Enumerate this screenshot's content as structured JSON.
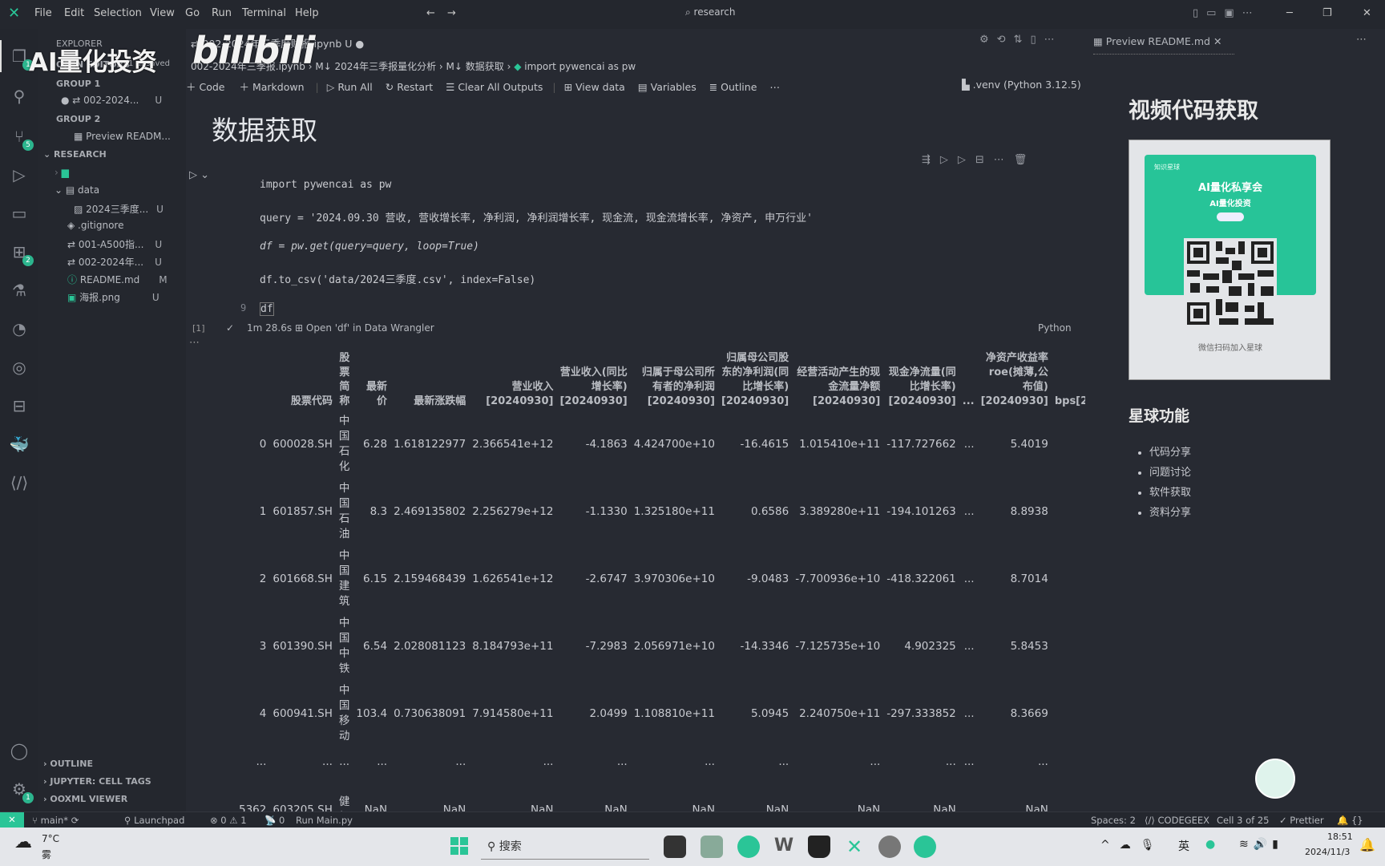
{
  "menu": [
    "File",
    "Edit",
    "Selection",
    "View",
    "Go",
    "Run",
    "Terminal",
    "Help"
  ],
  "search": "research",
  "watermark": {
    "channel": "AI量化投资",
    "logo": "bilibili"
  },
  "sidebar": {
    "title": "EXPLORER",
    "open_editors": "OPEN EDITORS",
    "open_editors_count": "1 unsaved",
    "group1": "GROUP 1",
    "group1_item": "002-2024...",
    "group1_status": "U",
    "group2": "GROUP 2",
    "group2_item": "Preview READM...",
    "research": "RESEARCH",
    "tree": [
      {
        "label": "data",
        "status": ""
      },
      {
        "label": "2024三季度...",
        "status": "U"
      },
      {
        "label": ".gitignore",
        "status": ""
      },
      {
        "label": "001-A500指...",
        "status": "U"
      },
      {
        "label": "002-2024年...",
        "status": "U"
      },
      {
        "label": "README.md",
        "status": "M"
      },
      {
        "label": "海报.png",
        "status": "U"
      }
    ],
    "outline": "OUTLINE",
    "cell_tags": "JUPYTER: CELL TAGS",
    "ooxml": "OOXML VIEWER"
  },
  "editor": {
    "tab": "002-2024年三季度财报.ipynb",
    "tab_status": "U",
    "breadcrumb": [
      "002-2024年三季报.ipynb",
      "M↓ 2024年三季报量化分析",
      "M↓ 数据获取",
      "import pywencai as pw"
    ],
    "toolbar": [
      "Code",
      "Markdown",
      "Run All",
      "Restart",
      "Clear All Outputs",
      "View data",
      "Variables",
      "Outline"
    ],
    "kernel": ".venv (Python 3.12.5)",
    "heading": "数据获取",
    "code": [
      "import pywencai as pw",
      "query = '2024.09.30 营收, 营收增长率, 净利润, 净利润增长率, 现金流, 现金流增长率, 净资产, 申万行业'",
      "df = pw.get(query=query, loop=True)",
      "df.to_csv('data/2024三季度.csv', index=False)",
      "df"
    ],
    "last_line_number": "9",
    "exec_count": "[1]",
    "exec_time": "1m 28.6s",
    "data_wrangler": "Open 'df' in Data Wrangler",
    "language": "Python"
  },
  "table": {
    "headers": [
      "",
      "股票代码",
      "股票简称",
      "最新价",
      "最新涨跌幅",
      "营业收入[20240930]",
      "营业收入(同比增长率)[20240930]",
      "归属于母公司所有者的净利润[20240930]",
      "归属母公司股东的净利润(同比增长率)[20240930]",
      "经营活动产生的现金流量净额[20240930]",
      "现金净流量(同比增长率)[20240930]",
      "...",
      "净资产收益率roe(摊薄,公布值)[20240930]",
      "bps[2"
    ],
    "rows": [
      [
        "0",
        "600028.SH",
        "中国石化",
        "6.28",
        "1.618122977",
        "2.366541e+12",
        "-4.1863",
        "4.424700e+10",
        "-16.4615",
        "1.015410e+11",
        "-117.727662",
        "...",
        "5.4019",
        ""
      ],
      [
        "1",
        "601857.SH",
        "中国石油",
        "8.3",
        "2.469135802",
        "2.256279e+12",
        "-1.1330",
        "1.325180e+11",
        "0.6586",
        "3.389280e+11",
        "-194.101263",
        "...",
        "8.8938",
        ""
      ],
      [
        "2",
        "601668.SH",
        "中国建筑",
        "6.15",
        "2.159468439",
        "1.626541e+12",
        "-2.6747",
        "3.970306e+10",
        "-9.0483",
        "-7.700936e+10",
        "-418.322061",
        "...",
        "8.7014",
        ""
      ],
      [
        "3",
        "601390.SH",
        "中国中铁",
        "6.54",
        "2.028081123",
        "8.184793e+11",
        "-7.2983",
        "2.056971e+10",
        "-14.3346",
        "-7.125735e+10",
        "4.902325",
        "...",
        "5.8453",
        ""
      ],
      [
        "4",
        "600941.SH",
        "中国移动",
        "103.4",
        "0.730638091",
        "7.914580e+11",
        "2.0499",
        "1.108810e+11",
        "5.0945",
        "2.240750e+11",
        "-297.333852",
        "...",
        "8.3669",
        ""
      ],
      [
        "...",
        "...",
        "...",
        "...",
        "...",
        "...",
        "...",
        "...",
        "...",
        "...",
        "...",
        "...",
        "...",
        ""
      ],
      [
        "5362",
        "603205.SH",
        "健帆",
        "NaN",
        "NaN",
        "NaN",
        "NaN",
        "NaN",
        "NaN",
        "NaN",
        "NaN",
        "...",
        "NaN",
        ""
      ]
    ]
  },
  "preview": {
    "tab": "Preview README.md",
    "h1": "视频代码获取",
    "poster_top": "知识星球",
    "poster_title": "AI量化私享会",
    "poster_sub": "AI量化投资",
    "poster_caption": "微信扫码加入星球",
    "h2": "星球功能",
    "features": [
      "代码分享",
      "问题讨论",
      "软件获取",
      "资料分享"
    ]
  },
  "status": {
    "branch": "main*",
    "launchpad": "Launchpad",
    "problems": "⊗ 0 ⚠ 1",
    "ports": "0",
    "run": "Run Main.py",
    "spaces": "Spaces: 2",
    "codegeex": "CODEGEEX",
    "cell": "Cell 3 of 25",
    "prettier": "Prettier"
  },
  "taskbar": {
    "temp": "7°C",
    "weather": "雾",
    "search": "搜索",
    "ime": "英",
    "time": "18:51",
    "date": "2024/11/3"
  },
  "colors": {
    "accent": "#2ac597",
    "bg": "#272a32"
  }
}
